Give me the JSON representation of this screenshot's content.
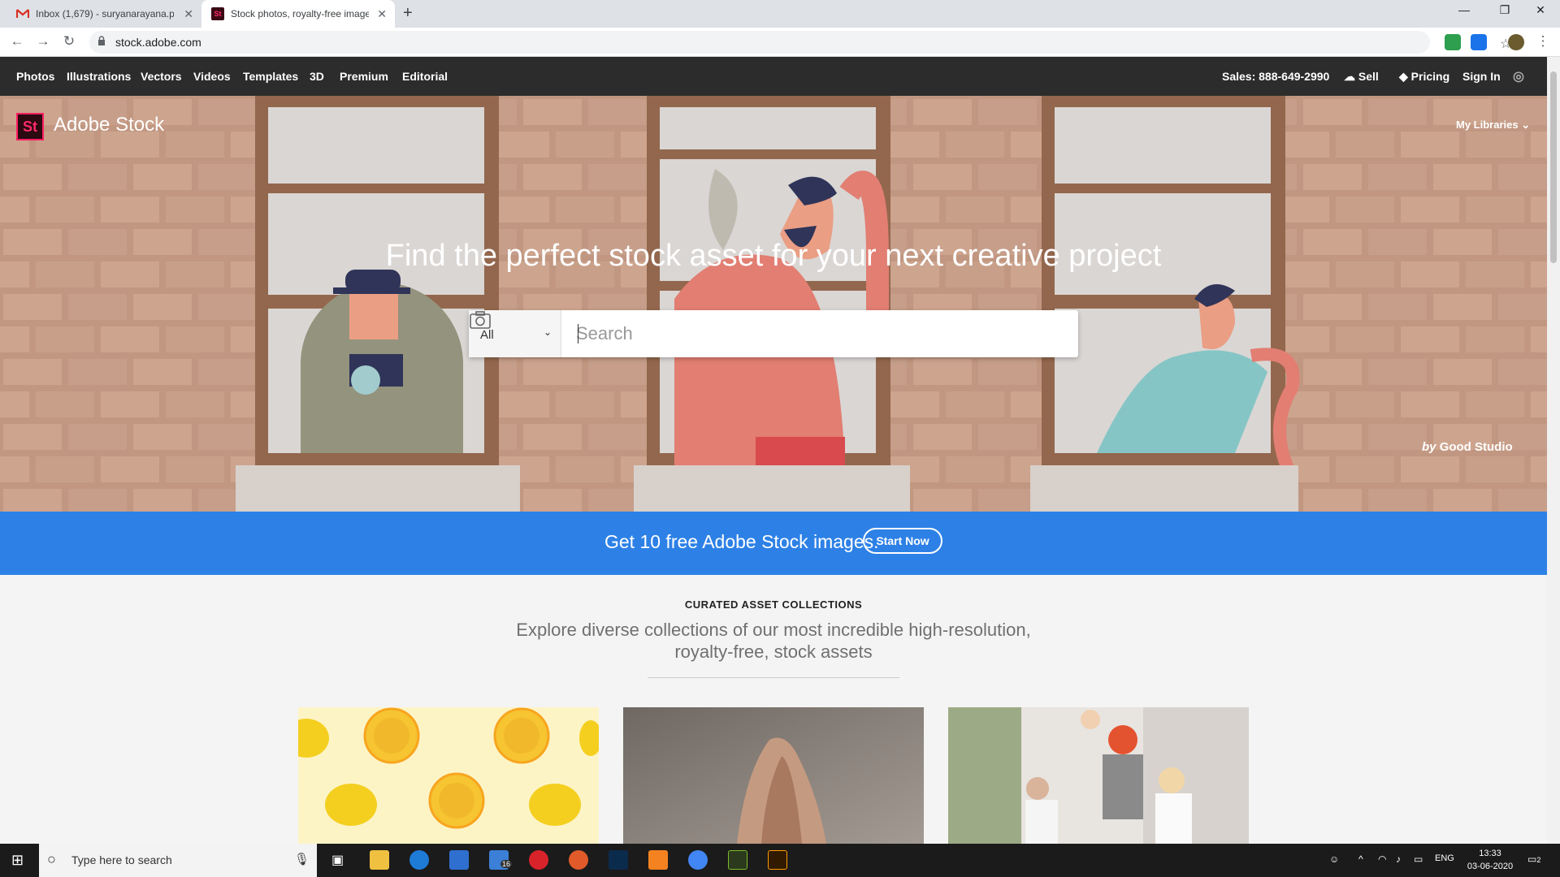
{
  "browser": {
    "tabs": [
      {
        "title": "Inbox (1,679) - suryanarayana.p",
        "favicon": "gmail-icon"
      },
      {
        "title": "Stock photos, royalty-free image",
        "favicon": "adobe-stock-icon"
      }
    ],
    "url": "stock.adobe.com"
  },
  "site_nav": {
    "items": [
      "Photos",
      "Illustrations",
      "Vectors",
      "Videos",
      "Templates",
      "3D",
      "Premium",
      "Editorial"
    ],
    "sales": "Sales: 888-649-2990",
    "sell": "Sell",
    "pricing": "Pricing",
    "sign_in": "Sign In"
  },
  "hero": {
    "logo_mark": "St",
    "logo_text": "Adobe Stock",
    "my_libraries": "My Libraries",
    "headline": "Find the perfect stock asset for your next creative project",
    "search": {
      "category": "All",
      "placeholder": "Search"
    },
    "credit_by": "by",
    "credit_name": "Good Studio"
  },
  "promo": {
    "text": "Get 10 free Adobe Stock images.",
    "button": "Start Now"
  },
  "collections": {
    "eyebrow": "CURATED ASSET COLLECTIONS",
    "subtitle": "Explore diverse collections of our most incredible high-resolution, royalty-free, stock assets"
  },
  "taskbar": {
    "search_placeholder": "Type here to search",
    "mail_badge": "16",
    "lang": "ENG",
    "time": "13:33",
    "date": "03-06-2020",
    "notifications": "2"
  },
  "colors": {
    "nav_bg": "#2c2c2c",
    "promo_blue": "#2d81e6",
    "adobe_pink": "#ff2a67",
    "hero_brick": "#b98c73"
  }
}
